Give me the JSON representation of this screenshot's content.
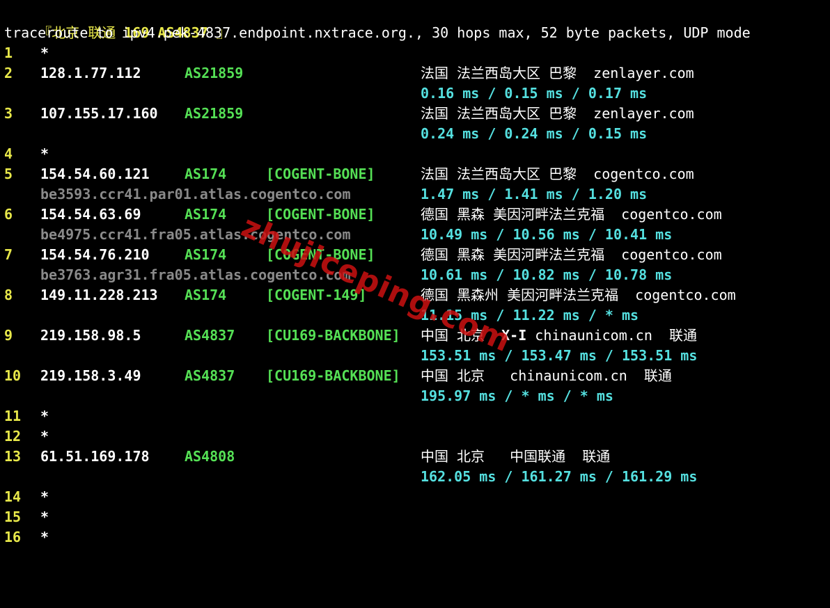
{
  "header": {
    "open_bracket": "『",
    "location": "北京 联通 ",
    "network": "169 AS4837",
    "close_bracket": " 』"
  },
  "command": "traceroute to ipv4.pek-4837.endpoint.nxtrace.org., 30 hops max, 52 byte packets, UDP mode",
  "hops": [
    {
      "num": "1",
      "star": "*"
    },
    {
      "num": "2",
      "ip": "128.1.77.112",
      "asn": "AS21859",
      "tag": "",
      "geo": "法国 法兰西岛大区 巴黎  zenlayer.com",
      "host": "",
      "rtt": "0.16 ms / 0.15 ms / 0.17 ms"
    },
    {
      "num": "3",
      "ip": "107.155.17.160",
      "asn": "AS21859",
      "tag": "",
      "geo": "法国 法兰西岛大区 巴黎  zenlayer.com",
      "host": "",
      "rtt": "0.24 ms / 0.24 ms / 0.15 ms"
    },
    {
      "num": "4",
      "star": "*"
    },
    {
      "num": "5",
      "ip": "154.54.60.121",
      "asn": "AS174",
      "tag": "[COGENT-BONE]",
      "geo": "法国 法兰西岛大区 巴黎  cogentco.com",
      "host": "be3593.ccr41.par01.atlas.cogentco.com",
      "rtt": "1.47 ms / 1.41 ms / 1.20 ms"
    },
    {
      "num": "6",
      "ip": "154.54.63.69",
      "asn": "AS174",
      "tag": "[COGENT-BONE]",
      "geo": "德国 黑森 美因河畔法兰克福  cogentco.com",
      "host": "be4975.ccr41.fra05.atlas.cogentco.com",
      "rtt": "10.49 ms / 10.56 ms / 10.41 ms"
    },
    {
      "num": "7",
      "ip": "154.54.76.210",
      "asn": "AS174",
      "tag": "[COGENT-BONE]",
      "geo": "德国 黑森 美因河畔法兰克福  cogentco.com",
      "host": "be3763.agr31.fra05.atlas.cogentco.com",
      "rtt": "10.61 ms / 10.82 ms / 10.78 ms"
    },
    {
      "num": "8",
      "ip": "149.11.228.213",
      "asn": "AS174",
      "tag": "[COGENT-149]",
      "geo": "德国 黑森州 美因河畔法兰克福  cogentco.com",
      "host": "",
      "rtt": "11.15 ms / 11.22 ms / * ms"
    },
    {
      "num": "9",
      "ip": "219.158.98.5",
      "asn": "AS4837",
      "tag": "[CU169-BACKBONE]",
      "geo_pre": "中国 北京  ",
      "geo_bold": "X-I",
      "geo_post": " chinaunicom.cn  联通",
      "host": "",
      "rtt": "153.51 ms / 153.47 ms / 153.51 ms"
    },
    {
      "num": "10",
      "ip": "219.158.3.49",
      "asn": "AS4837",
      "tag": "[CU169-BACKBONE]",
      "geo": "中国 北京   chinaunicom.cn  联通",
      "host": "",
      "rtt": "195.97 ms / * ms / * ms"
    },
    {
      "num": "11",
      "star": "*"
    },
    {
      "num": "12",
      "star": "*"
    },
    {
      "num": "13",
      "ip": "61.51.169.178",
      "asn": "AS4808",
      "tag": "",
      "geo": "中国 北京   中国联通  联通",
      "host": "",
      "rtt": "162.05 ms / 161.27 ms / 161.29 ms"
    },
    {
      "num": "14",
      "star": "*"
    },
    {
      "num": "15",
      "star": "*"
    },
    {
      "num": "16",
      "star": "*"
    }
  ],
  "watermark": "zhujiceping.com",
  "colors": {
    "background": "#000000",
    "hop_number": "#e8e84a",
    "asn_tag": "#55e055",
    "rtt": "#55e0e0",
    "hostname": "#8a8a8a",
    "watermark": "#cc1111"
  }
}
